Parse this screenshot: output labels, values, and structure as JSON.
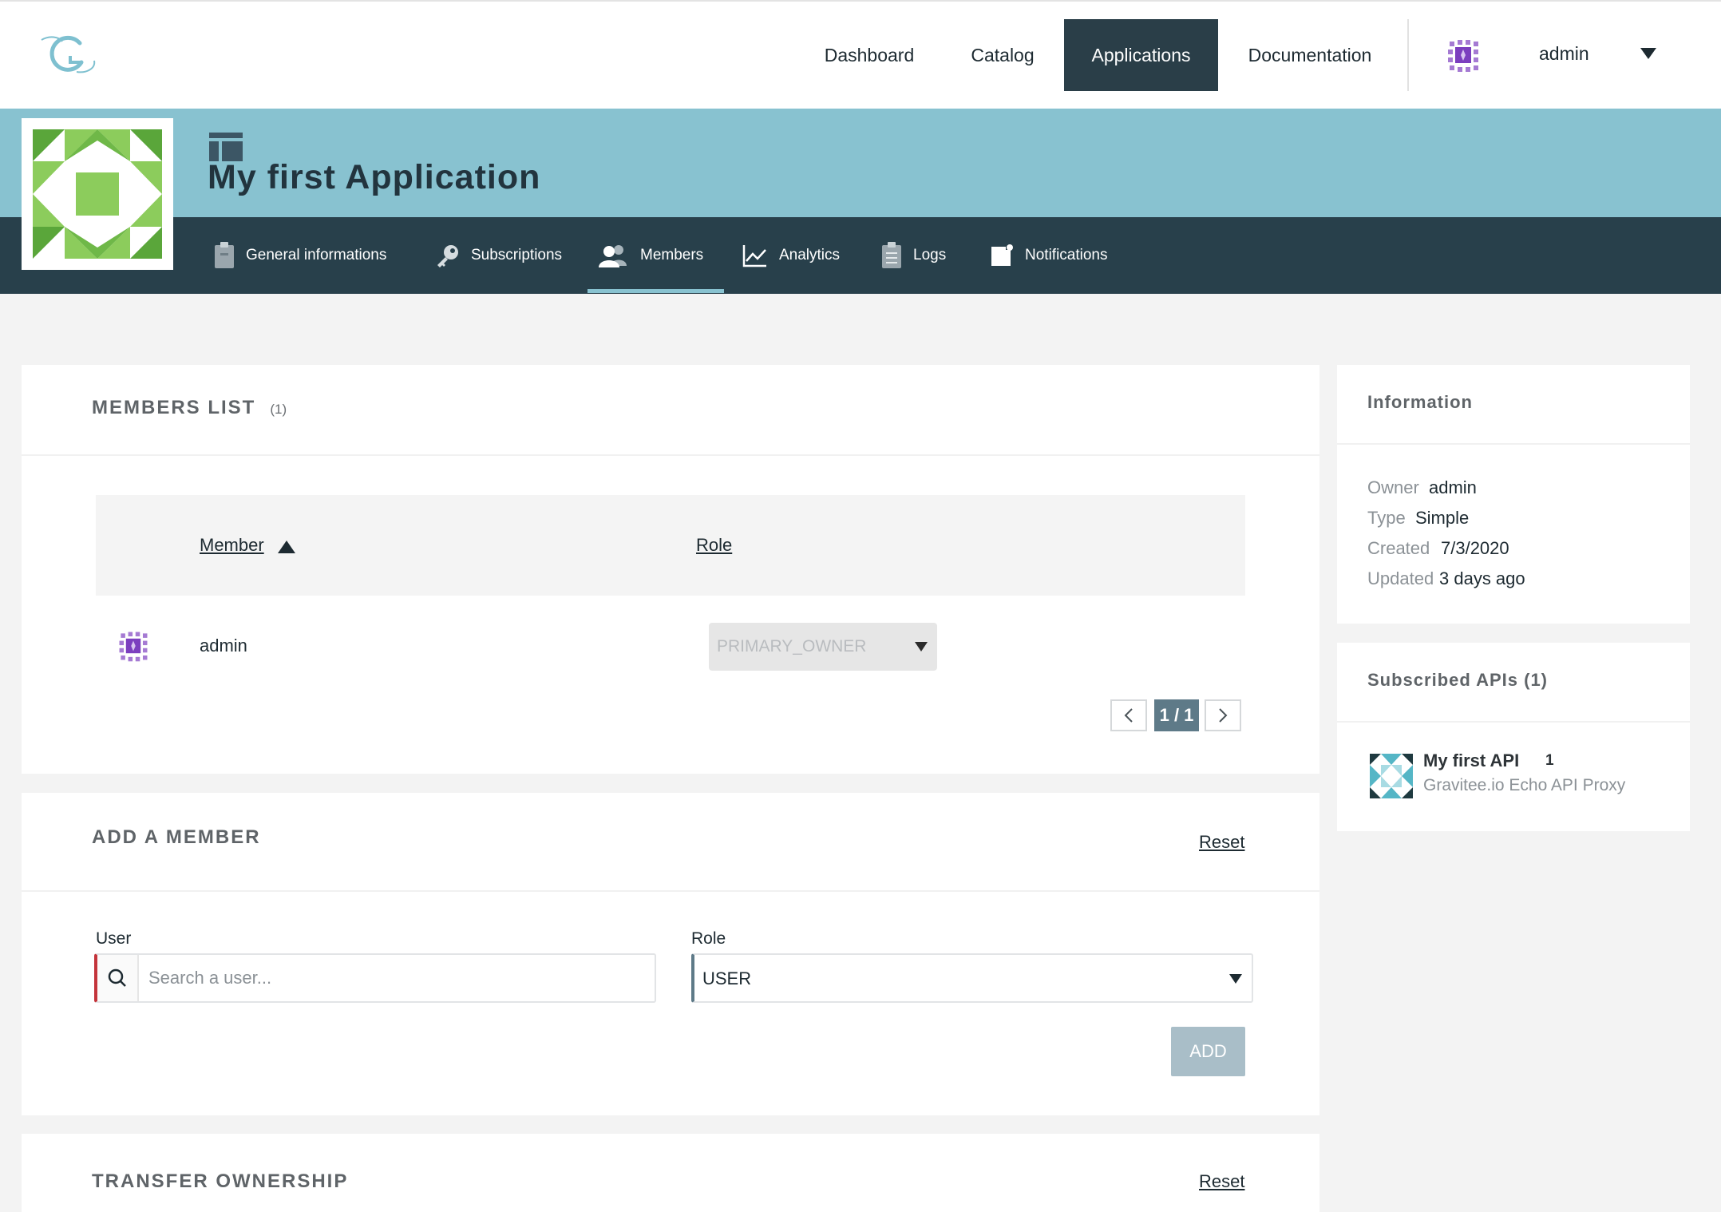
{
  "nav": {
    "items": [
      {
        "label": "Dashboard"
      },
      {
        "label": "Catalog"
      },
      {
        "label": "Applications",
        "active": true
      },
      {
        "label": "Documentation"
      }
    ],
    "user": "admin"
  },
  "app": {
    "title": "My first Application"
  },
  "tabs": [
    {
      "label": "General informations",
      "icon": "clipboard-icon"
    },
    {
      "label": "Subscriptions",
      "icon": "key-icon"
    },
    {
      "label": "Members",
      "icon": "users-icon",
      "active": true
    },
    {
      "label": "Analytics",
      "icon": "chart-icon"
    },
    {
      "label": "Logs",
      "icon": "list-icon"
    },
    {
      "label": "Notifications",
      "icon": "notification-icon"
    }
  ],
  "members": {
    "title": "MEMBERS LIST",
    "count": "(1)",
    "columns": {
      "member": "Member",
      "role": "Role"
    },
    "rows": [
      {
        "member": "admin",
        "role": "PRIMARY_OWNER"
      }
    ],
    "pagination": "1 / 1"
  },
  "add_member": {
    "title": "ADD A MEMBER",
    "reset": "Reset",
    "user_label": "User",
    "user_placeholder": "Search a user...",
    "role_label": "Role",
    "role_value": "USER",
    "add_label": "ADD"
  },
  "transfer": {
    "title": "TRANSFER OWNERSHIP",
    "reset": "Reset"
  },
  "information": {
    "title": "Information",
    "owner_label": "Owner",
    "owner": "admin",
    "type_label": "Type",
    "type": "Simple",
    "created_label": "Created",
    "created": "7/3/2020",
    "updated_label": "Updated",
    "updated": "3 days ago"
  },
  "subscribed": {
    "title": "Subscribed APIs (1)",
    "apis": [
      {
        "name": "My first API",
        "version": "1",
        "description": "Gravitee.io Echo API Proxy"
      }
    ]
  },
  "colors": {
    "nav_active": "#2a3e48",
    "header": "#88c2d0",
    "tabbar": "#28404b",
    "error_border": "#c4343b",
    "add_button": "#a9bec8"
  }
}
